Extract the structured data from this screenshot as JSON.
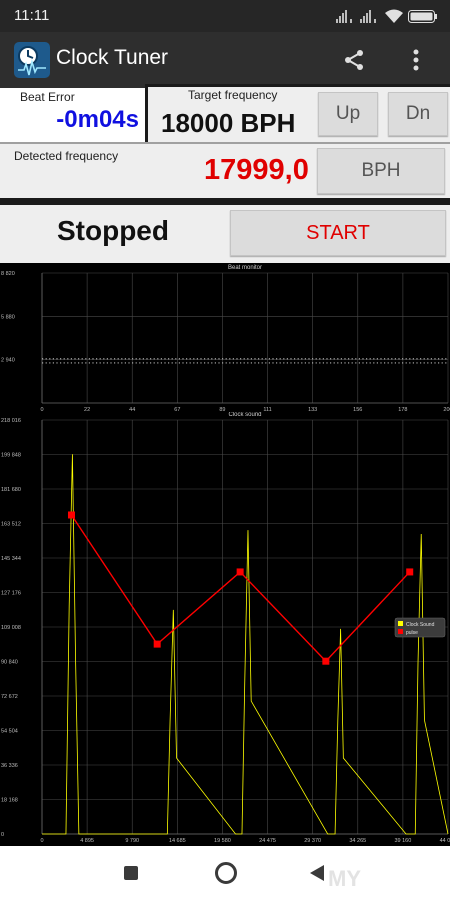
{
  "status_bar": {
    "time": "11:11",
    "battery_icon": "battery-icon",
    "wifi_icon": "wifi-icon",
    "signal_icon": "signal-icon"
  },
  "app_bar": {
    "title": "Clock Tuner",
    "app_icon": "clock-tuner-icon",
    "share_icon": "share-icon",
    "menu_icon": "more-vert-icon"
  },
  "beat_error": {
    "label": "Beat Error",
    "value": "-0m04s"
  },
  "target": {
    "label": "Target frequency",
    "value": "18000 BPH",
    "up_label": "Up",
    "down_label": "Dn"
  },
  "detected": {
    "label": "Detected frequency",
    "value": "17999,0",
    "unit_button": "BPH"
  },
  "status": {
    "state": "Stopped",
    "start_label": "START"
  },
  "colors": {
    "beat_error_value": "#1010e0",
    "detected_value": "#e00000",
    "start_label": "#e00000",
    "pulse_series": "#ff0000",
    "clock_sound_series": "#ffff00"
  },
  "nav_bar": {
    "recents_icon": "square-icon",
    "home_icon": "circle-icon",
    "back_icon": "triangle-back-icon",
    "watermark": "MY"
  },
  "chart_data": [
    {
      "type": "scatter",
      "title": "Beat monitor",
      "xlim": [
        0,
        200
      ],
      "ylim": [
        0,
        8820
      ],
      "x_ticks": [
        "0",
        "22",
        "44",
        "67",
        "89",
        "111",
        "133",
        "156",
        "178",
        "200"
      ],
      "y_ticks": [
        "8 820",
        "5 880",
        "2 940"
      ],
      "series": [
        {
          "values": [
            {
              "x_from": 0,
              "x_to": 200,
              "y": 3000
            }
          ]
        },
        {
          "values": [
            {
              "x_from": 0,
              "x_to": 200,
              "y": 2720
            }
          ]
        }
      ],
      "grid": true
    },
    {
      "type": "line",
      "title": "Clock sound",
      "xlim": [
        0,
        44055
      ],
      "ylim": [
        0,
        218016
      ],
      "x_ticks": [
        "0",
        "4 895",
        "9 790",
        "14 685",
        "19 580",
        "24 475",
        "29 370",
        "34 265",
        "39 160",
        "44 055"
      ],
      "y_ticks": [
        "218 016",
        "199 848",
        "181 680",
        "163 512",
        "145 344",
        "127 176",
        "109 008",
        "90 840",
        "72 672",
        "54 504",
        "36 336",
        "18 168",
        "0"
      ],
      "legend": {
        "placement": "right",
        "entries": [
          "Clock Sound",
          "pulse"
        ]
      },
      "series": [
        {
          "name": "Clock Sound",
          "x": [
            0,
            2600,
            2950,
            3300,
            3650,
            4000,
            12000,
            13600,
            13900,
            14250,
            14600,
            21000,
            21700,
            22000,
            22350,
            22700,
            31000,
            31800,
            32100,
            32400,
            32700,
            39500,
            40500,
            40800,
            41150,
            41500,
            44055
          ],
          "y": [
            0,
            0,
            120000,
            200000,
            90000,
            0,
            0,
            0,
            60000,
            118000,
            40000,
            0,
            0,
            80000,
            160000,
            70000,
            0,
            0,
            60000,
            108000,
            40000,
            0,
            0,
            90000,
            158000,
            60000,
            0
          ]
        },
        {
          "name": "pulse",
          "x": [
            3200,
            12500,
            21500,
            30800,
            39900
          ],
          "y": [
            168000,
            100000,
            138000,
            91000,
            138000
          ]
        }
      ],
      "grid": true
    }
  ]
}
